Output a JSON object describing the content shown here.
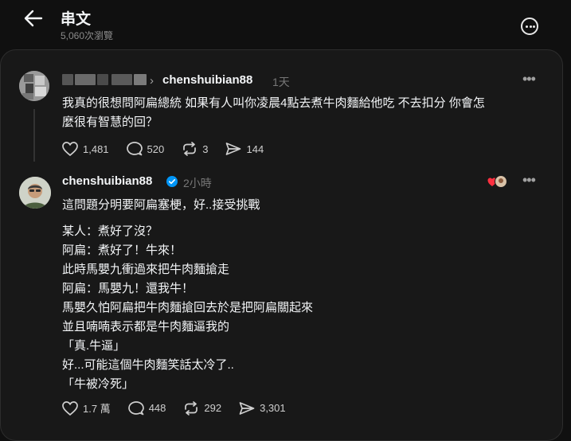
{
  "header": {
    "title": "串文",
    "views": "5,060次瀏覽"
  },
  "post": {
    "username": "chenshuibian88",
    "time": "1天",
    "text_line1": "我真的很想問阿扁總統 如果有人叫你凌晨4點去煮牛肉麵給他吃 不去扣分 你會怎",
    "text_line2": "麼很有智慧的回？",
    "likes": "1,481",
    "comments": "520",
    "reposts": "3",
    "shares": "144"
  },
  "reply": {
    "username": "chenshuibian88",
    "time": "2小時",
    "lines": [
      "這問題分明要阿扁塞梗，好..接受挑戰",
      "某人：煮好了沒？",
      "阿扁：煮好了！牛來！",
      "此時馬嬰九衝過來把牛肉麵搶走",
      "阿扁：馬嬰九！還我牛！",
      "馬嬰久怕阿扁把牛肉麵搶回去於是把阿扁關起來",
      "並且喃喃表示都是牛肉麵逼我的",
      "「真.牛逼」",
      "好...可能這個牛肉麵笑話太冷了..",
      "「牛被冷死」"
    ],
    "likes": "1.7 萬",
    "comments": "448",
    "reposts": "292",
    "shares": "3,301"
  },
  "colors": {
    "background": "#101010",
    "card": "#181818",
    "verified": "#0095f6",
    "heart": "#ff3040"
  }
}
